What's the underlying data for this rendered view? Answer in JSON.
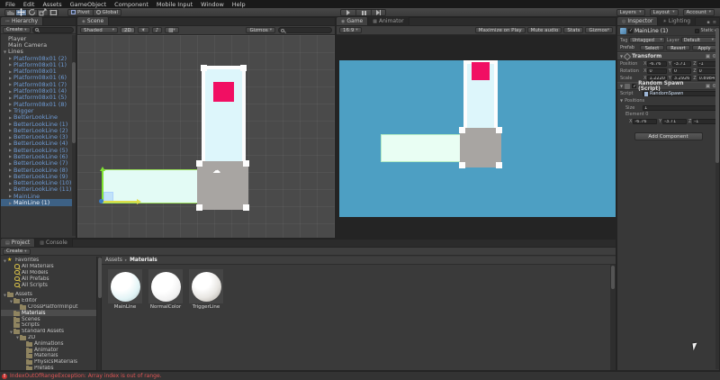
{
  "window": {
    "menu_items": [
      "File",
      "Edit",
      "Assets",
      "GameObject",
      "Component",
      "Mobile Input",
      "Window",
      "Help"
    ]
  },
  "toolbar": {
    "tools": [
      "pan-tool",
      "move-tool",
      "rotate-tool",
      "scale-tool",
      "rect-tool"
    ],
    "active_tool": "move-tool",
    "pivot_label": "Pivot",
    "global_label": "Global",
    "transport": [
      "play",
      "pause",
      "step"
    ],
    "right_dropdowns": [
      "Layers",
      "Layout",
      "Account"
    ]
  },
  "hierarchy": {
    "tab_label": "Hierarchy",
    "create_label": "Create",
    "items": [
      {
        "label": "Player",
        "tog": "",
        "cls": "plain"
      },
      {
        "label": "Main Camera",
        "tog": "",
        "cls": "plain"
      },
      {
        "label": "Lines",
        "tog": "▼",
        "cls": "plain"
      },
      {
        "label": "Platform08x01 (2)",
        "tog": "▶",
        "cls": "prefab child"
      },
      {
        "label": "Platform08x01 (1)",
        "tog": "▶",
        "cls": "prefab child"
      },
      {
        "label": "Platform08x01",
        "tog": "▶",
        "cls": "prefab child"
      },
      {
        "label": "Platform08x01 (6)",
        "tog": "▶",
        "cls": "prefab child"
      },
      {
        "label": "Platform08x01 (7)",
        "tog": "▶",
        "cls": "prefab child"
      },
      {
        "label": "Platform08x01 (4)",
        "tog": "▶",
        "cls": "prefab child"
      },
      {
        "label": "Platform08x01 (5)",
        "tog": "▶",
        "cls": "prefab child"
      },
      {
        "label": "Platform08x01 (8)",
        "tog": "▶",
        "cls": "prefab child"
      },
      {
        "label": "Trigger",
        "tog": "▶",
        "cls": "prefab child"
      },
      {
        "label": "BetterLookLine",
        "tog": "▶",
        "cls": "prefab child"
      },
      {
        "label": "BetterLookLine (1)",
        "tog": "▶",
        "cls": "prefab child"
      },
      {
        "label": "BetterLookLine (2)",
        "tog": "▶",
        "cls": "prefab child"
      },
      {
        "label": "BetterLookLine (3)",
        "tog": "▶",
        "cls": "prefab child"
      },
      {
        "label": "BetterLookLine (4)",
        "tog": "▶",
        "cls": "prefab child"
      },
      {
        "label": "BetterLookLine (5)",
        "tog": "▶",
        "cls": "prefab child"
      },
      {
        "label": "BetterLookLine (6)",
        "tog": "▶",
        "cls": "prefab child"
      },
      {
        "label": "BetterLookLine (7)",
        "tog": "▶",
        "cls": "prefab child"
      },
      {
        "label": "BetterLookLine (8)",
        "tog": "▶",
        "cls": "prefab child"
      },
      {
        "label": "BetterLookLine (9)",
        "tog": "▶",
        "cls": "prefab child"
      },
      {
        "label": "BetterLookLine (10)",
        "tog": "▶",
        "cls": "prefab child"
      },
      {
        "label": "BetterLookLine (11)",
        "tog": "▶",
        "cls": "prefab child"
      },
      {
        "label": "MainLine",
        "tog": "▶",
        "cls": "prefab child"
      },
      {
        "label": "MainLine (1)",
        "tog": "▶",
        "cls": "prefab child sel"
      }
    ]
  },
  "scene": {
    "tab_label": "Scene",
    "shaded_label": "Shaded",
    "mode2d_label": "2D",
    "gizmos_label": "Gizmos"
  },
  "game": {
    "tab_label": "Game",
    "animator_tab_label": "Animator",
    "aspect": "16:9",
    "buttons": [
      {
        "label": "Maximize on Play",
        "arrow": ""
      },
      {
        "label": "Mute audio",
        "arrow": ""
      },
      {
        "label": "Stats",
        "arrow": ""
      },
      {
        "label": "Gizmos",
        "arrow": "▾"
      }
    ]
  },
  "inspector": {
    "tab_label": "Inspector",
    "lighting_tab_label": "Lighting",
    "object_name": "MainLine (1)",
    "static_label": "Static",
    "tag_label": "Tag",
    "tag_value": "Untagged",
    "layer_label": "Layer",
    "layer_value": "Default",
    "prefab_label": "Prefab",
    "prefab_buttons": [
      "Select",
      "Revert",
      "Apply"
    ],
    "axes": [
      "X",
      "Y",
      "Z"
    ],
    "transform": {
      "title": "Transform",
      "rows": [
        {
          "label": "Position",
          "x": "-6.76",
          "y": "-3.71",
          "z": "-1"
        },
        {
          "label": "Rotation",
          "x": "0",
          "y": "0",
          "z": "0"
        },
        {
          "label": "Scale",
          "x": "1.2220",
          "y": "3.2926",
          "z": "0.8984"
        }
      ]
    },
    "random_spawn": {
      "title": "Random Spawn (Script)",
      "script_label": "Script",
      "script_value": "RandomSpawn",
      "positions_label": "Positions",
      "size_label": "Size",
      "size_value": "1",
      "element_label": "Element 0",
      "element_rows": [
        {
          "label": "",
          "x": "-6.76",
          "y": "-3.71",
          "z": "-1"
        }
      ]
    },
    "add_component_label": "Add Component"
  },
  "project": {
    "tab_label": "Project",
    "console_tab_label": "Console",
    "create_label": "Create",
    "tree": [
      {
        "label": "Favorites",
        "tog": "▼",
        "icon": "star",
        "cls": "d0"
      },
      {
        "label": "All Materials",
        "tog": "",
        "icon": "search",
        "cls": "d1"
      },
      {
        "label": "All Models",
        "tog": "",
        "icon": "search",
        "cls": "d1"
      },
      {
        "label": "All Prefabs",
        "tog": "",
        "icon": "search",
        "cls": "d1"
      },
      {
        "label": "All Scripts",
        "tog": "",
        "icon": "search",
        "cls": "d1"
      },
      {
        "label": "",
        "tog": "",
        "icon": "none",
        "cls": "spacer"
      },
      {
        "label": "Assets",
        "tog": "▼",
        "icon": "folder",
        "cls": "d0"
      },
      {
        "label": "Editor",
        "tog": "▼",
        "icon": "folder",
        "cls": "d1"
      },
      {
        "label": "CrossPlatformInput",
        "tog": "",
        "icon": "folder",
        "cls": "d2"
      },
      {
        "label": "Materials",
        "tog": "",
        "icon": "folder",
        "cls": "d1 sel"
      },
      {
        "label": "Scenes",
        "tog": "",
        "icon": "folder",
        "cls": "d1"
      },
      {
        "label": "Scripts",
        "tog": "",
        "icon": "folder",
        "cls": "d1"
      },
      {
        "label": "Standard Assets",
        "tog": "▼",
        "icon": "folder",
        "cls": "d1"
      },
      {
        "label": "2D",
        "tog": "▼",
        "icon": "folder",
        "cls": "d2"
      },
      {
        "label": "Animations",
        "tog": "",
        "icon": "folder",
        "cls": "d3"
      },
      {
        "label": "Animator",
        "tog": "",
        "icon": "folder",
        "cls": "d3"
      },
      {
        "label": "Materials",
        "tog": "",
        "icon": "folder",
        "cls": "d3"
      },
      {
        "label": "PhysicsMaterials",
        "tog": "",
        "icon": "folder",
        "cls": "d3"
      },
      {
        "label": "Prefabs",
        "tog": "",
        "icon": "folder",
        "cls": "d3"
      }
    ],
    "breadcrumb": {
      "root": "Assets",
      "sep": "▸",
      "current": "Materials"
    },
    "materials": [
      {
        "label": "MainLine",
        "cls": "m-main"
      },
      {
        "label": "NormalColor",
        "cls": "m-normal"
      },
      {
        "label": "TriggerLine",
        "cls": "m-trigger"
      }
    ]
  },
  "status": {
    "text": "IndexOutOfRangeException: Array index is out of range."
  },
  "colors": {
    "selection_blue": "#3d6185",
    "prefab_text": "#6f9dd8",
    "error_red": "#e05555",
    "game_sky": "#4d9fc3",
    "pink_block": "#f10f63",
    "platform_fill": "#e3fbf5",
    "gray_block": "#a8a5a2"
  }
}
